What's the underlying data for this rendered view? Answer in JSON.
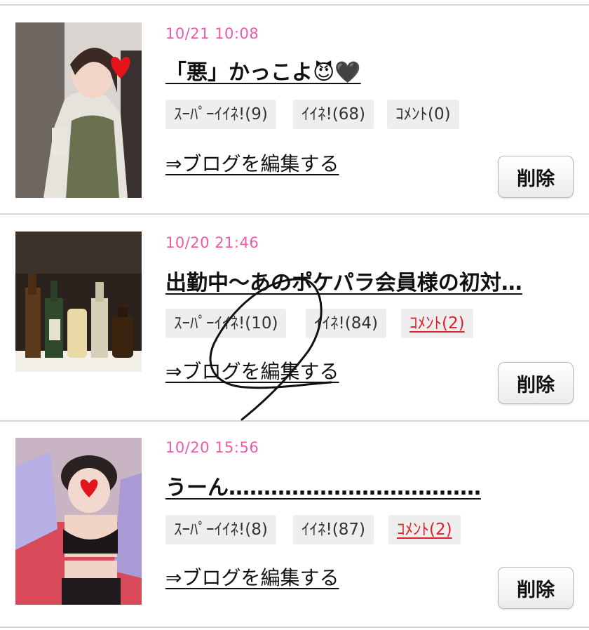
{
  "entries": [
    {
      "date": "10/21 10:08",
      "title": "「悪」かっこよ😈🖤",
      "super_like": "ｽｰﾊﾟｰｲｲﾈ!(9)",
      "like": "ｲｲﾈ!(68)",
      "comment": "ｺﾒﾝﾄ(0)",
      "comment_highlight": false,
      "edit_link": "⇒ブログを編集する",
      "delete_label": "削除",
      "thumbnail": "woman-in-green-dress-photo"
    },
    {
      "date": "10/20 21:46",
      "title": "出勤中〜あのポケパラ会員様の初対…",
      "super_like": "ｽｰﾊﾟｰｲｲﾈ!(10)",
      "like": "ｲｲﾈ!(84)",
      "comment": "ｺﾒﾝﾄ(2)",
      "comment_highlight": true,
      "edit_link": "⇒ブログを編集する",
      "delete_label": "削除",
      "thumbnail": "sake-bottles-photo"
    },
    {
      "date": "10/20 15:56",
      "title": "うーん………………………………",
      "super_like": "ｽｰﾊﾟｰｲｲﾈ!(8)",
      "like": "ｲｲﾈ!(87)",
      "comment": "ｺﾒﾝﾄ(2)",
      "comment_highlight": true,
      "edit_link": "⇒ブログを編集する",
      "delete_label": "削除",
      "thumbnail": "woman-selfie-photo"
    }
  ],
  "colors": {
    "date": "#f05aa6",
    "comment_highlight": "#e0202a",
    "badge_bg": "#eeeeee",
    "separator": "#d6d6d6"
  }
}
